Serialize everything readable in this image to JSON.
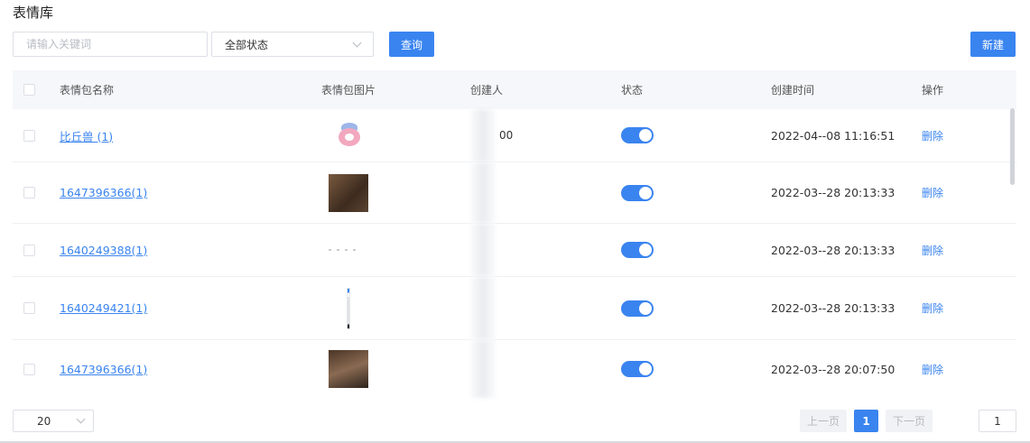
{
  "page_title": "表情库",
  "search": {
    "placeholder": "请输入关键词"
  },
  "status_filter": {
    "selected": "全部状态"
  },
  "query_label": "查询",
  "new_label": "新建",
  "table": {
    "headers": {
      "name": "表情包名称",
      "image": "表情包图片",
      "creator": "创建人",
      "status": "状态",
      "created_time": "创建时间",
      "action": "操作"
    },
    "rows": [
      {
        "name": "比丘兽 (1)",
        "image": "character-emoji",
        "creator": "00",
        "status": "on",
        "created_time": "2022-04--08 11:16:51",
        "action": "删除"
      },
      {
        "name": "1647396366(1)",
        "image": "photo-thumbnail",
        "creator": "",
        "status": "on",
        "created_time": "2022-03--28 20:13:33",
        "action": "删除"
      },
      {
        "name": "1640249388(1)",
        "image": "faint-thumbnail",
        "creator": "",
        "status": "on",
        "created_time": "2022-03--28 20:13:33",
        "action": "删除"
      },
      {
        "name": "1640249421(1)",
        "image": "narrow-bar-thumbnail",
        "creator": "",
        "status": "on",
        "created_time": "2022-03--28 20:13:33",
        "action": "删除"
      },
      {
        "name": "1647396366(1)",
        "image": "photo-thumbnail",
        "creator": "",
        "status": "on",
        "created_time": "2022-03--28 20:07:50",
        "action": "删除"
      }
    ]
  },
  "pagination": {
    "page_size": "20",
    "prev_label": "上一页",
    "current_page": "1",
    "next_label": "下一页",
    "jump_value": "1"
  },
  "colors": {
    "primary": "#3a84f0",
    "header_bg": "#f5f7fa",
    "border": "#dcdfe6"
  }
}
